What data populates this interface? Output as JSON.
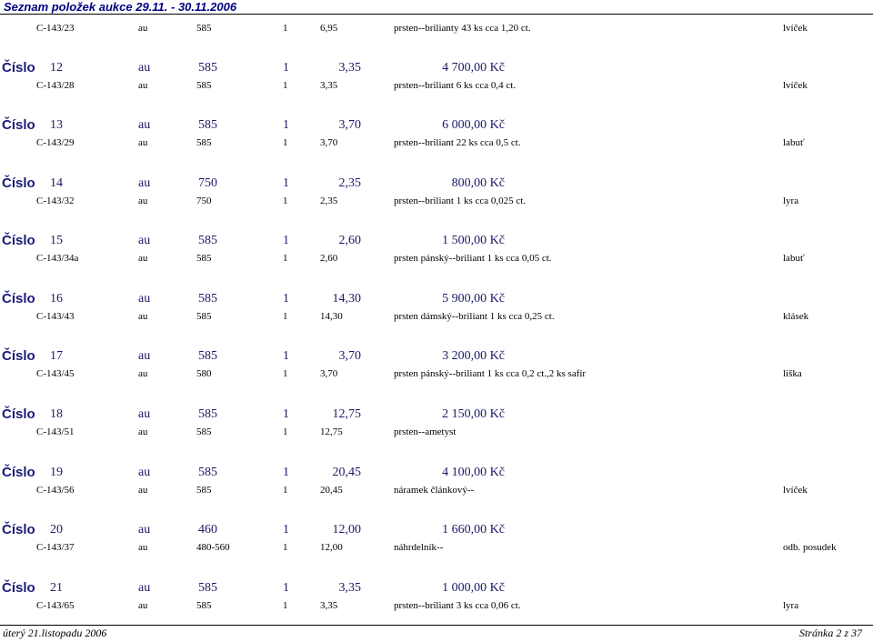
{
  "page_title": "Seznam položek aukce 29.11. - 30.11.2006",
  "cislo_label": "Číslo",
  "items": [
    {
      "detail": {
        "code": "C-143/23",
        "material": "au",
        "fineness": "585",
        "qty": "1",
        "weight": "6,95",
        "description": "prsten--brilianty 43 ks cca 1,20 ct.",
        "note": "lvíček"
      }
    },
    {
      "header": {
        "number": "12",
        "material": "au",
        "fineness": "585",
        "qty": "1",
        "weight": "3,35",
        "price": "4 700,00 Kč"
      },
      "detail": {
        "code": "C-143/28",
        "material": "au",
        "fineness": "585",
        "qty": "1",
        "weight": "3,35",
        "description": "prsten--briliant 6 ks cca 0,4 ct.",
        "note": "lvíček"
      }
    },
    {
      "header": {
        "number": "13",
        "material": "au",
        "fineness": "585",
        "qty": "1",
        "weight": "3,70",
        "price": "6 000,00 Kč"
      },
      "detail": {
        "code": "C-143/29",
        "material": "au",
        "fineness": "585",
        "qty": "1",
        "weight": "3,70",
        "description": "prsten--briliant 22 ks cca 0,5 ct.",
        "note": "labuť"
      }
    },
    {
      "header": {
        "number": "14",
        "material": "au",
        "fineness": "750",
        "qty": "1",
        "weight": "2,35",
        "price": "800,00 Kč"
      },
      "detail": {
        "code": "C-143/32",
        "material": "au",
        "fineness": "750",
        "qty": "1",
        "weight": "2,35",
        "description": "prsten--briliant 1 ks cca 0,025 ct.",
        "note": "lyra"
      }
    },
    {
      "header": {
        "number": "15",
        "material": "au",
        "fineness": "585",
        "qty": "1",
        "weight": "2,60",
        "price": "1 500,00 Kč"
      },
      "detail": {
        "code": "C-143/34a",
        "material": "au",
        "fineness": "585",
        "qty": "1",
        "weight": "2,60",
        "description": "prsten pánský--briliant 1 ks cca 0,05 ct.",
        "note": "labuť"
      }
    },
    {
      "header": {
        "number": "16",
        "material": "au",
        "fineness": "585",
        "qty": "1",
        "weight": "14,30",
        "price": "5 900,00 Kč"
      },
      "detail": {
        "code": "C-143/43",
        "material": "au",
        "fineness": "585",
        "qty": "1",
        "weight": "14,30",
        "description": "prsten dámský--briliant 1 ks cca 0,25 ct.",
        "note": "klásek"
      }
    },
    {
      "header": {
        "number": "17",
        "material": "au",
        "fineness": "585",
        "qty": "1",
        "weight": "3,70",
        "price": "3 200,00 Kč"
      },
      "detail": {
        "code": "C-143/45",
        "material": "au",
        "fineness": "580",
        "qty": "1",
        "weight": "3,70",
        "description": "prsten pánský--briliant 1 ks cca 0,2 ct.,2 ks safír",
        "note": "liška"
      }
    },
    {
      "header": {
        "number": "18",
        "material": "au",
        "fineness": "585",
        "qty": "1",
        "weight": "12,75",
        "price": "2 150,00 Kč"
      },
      "detail": {
        "code": "C-143/51",
        "material": "au",
        "fineness": "585",
        "qty": "1",
        "weight": "12,75",
        "description": "prsten--ametyst",
        "note": ""
      }
    },
    {
      "header": {
        "number": "19",
        "material": "au",
        "fineness": "585",
        "qty": "1",
        "weight": "20,45",
        "price": "4 100,00 Kč"
      },
      "detail": {
        "code": "C-143/56",
        "material": "au",
        "fineness": "585",
        "qty": "1",
        "weight": "20,45",
        "description": "náramek článkový--",
        "note": "lvíček"
      }
    },
    {
      "header": {
        "number": "20",
        "material": "au",
        "fineness": "460",
        "qty": "1",
        "weight": "12,00",
        "price": "1 660,00 Kč"
      },
      "detail": {
        "code": "C-143/37",
        "material": "au",
        "fineness": "480-560",
        "qty": "1",
        "weight": "12,00",
        "description": "náhrdelník--",
        "note": "odb. posudek"
      }
    },
    {
      "header": {
        "number": "21",
        "material": "au",
        "fineness": "585",
        "qty": "1",
        "weight": "3,35",
        "price": "1 000,00 Kč"
      },
      "detail": {
        "code": "C-143/65",
        "material": "au",
        "fineness": "585",
        "qty": "1",
        "weight": "3,35",
        "description": "prsten--briliant 3 ks cca 0,06 ct.",
        "note": "lyra"
      }
    }
  ],
  "footer": {
    "date": "úterý 21.listopadu 2006",
    "page": "Stránka 2 z 37"
  }
}
